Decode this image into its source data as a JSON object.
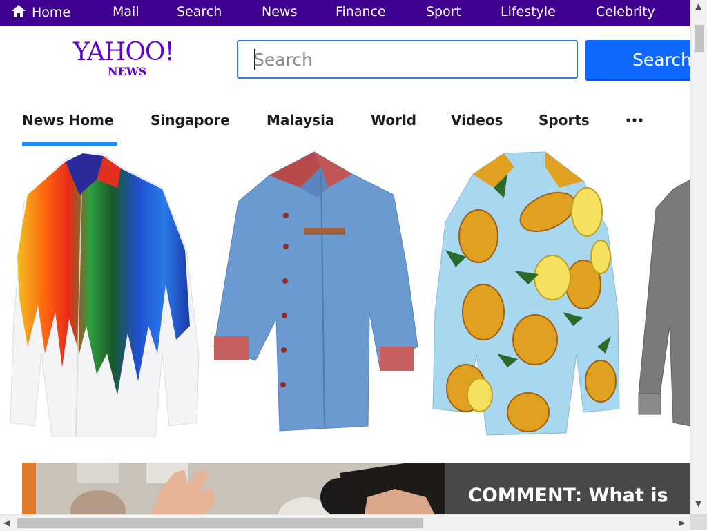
{
  "topnav": {
    "items": [
      {
        "label": "Home",
        "icon": "home-icon"
      },
      {
        "label": "Mail"
      },
      {
        "label": "Search"
      },
      {
        "label": "News"
      },
      {
        "label": "Finance"
      },
      {
        "label": "Sport"
      },
      {
        "label": "Lifestyle"
      },
      {
        "label": "Celebrity"
      }
    ],
    "background": "#400090"
  },
  "header": {
    "logo_main": "YAHOO!",
    "logo_sub": "NEWS",
    "logo_color": "#5f01d1",
    "search_placeholder": "Search",
    "search_value": "",
    "search_button": "Search",
    "search_button_color": "#0f69ff"
  },
  "sections": {
    "items": [
      "News Home",
      "Singapore",
      "Malaysia",
      "World",
      "Videos",
      "Sports"
    ],
    "more_icon": "more-dots-icon",
    "active": "News Home",
    "active_color": "#188fff"
  },
  "ad_carousel": {
    "tiles": [
      {
        "icon": "paint-drip-shirt-image"
      },
      {
        "icon": "denim-shirt-image"
      },
      {
        "icon": "pineapple-shirt-image"
      },
      {
        "icon": "grey-shirt-image"
      }
    ]
  },
  "story": {
    "headline": "COMMENT: What is"
  }
}
